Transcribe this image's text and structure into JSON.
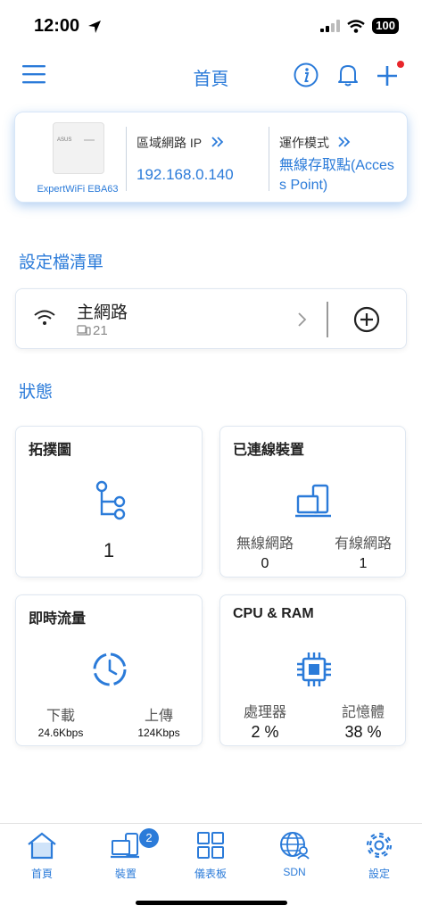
{
  "status_bar": {
    "time": "12:00",
    "battery": "100"
  },
  "header": {
    "title": "首頁"
  },
  "device": {
    "model": "ExpertWiFi EBA63",
    "ip_label": "區域網路 IP",
    "ip_value": "192.168.0.140",
    "mode_label": "運作模式",
    "mode_value": "無線存取點(Access Point)"
  },
  "profiles": {
    "title": "設定檔清單",
    "items": [
      {
        "name": "主網路",
        "count": "21"
      }
    ]
  },
  "status": {
    "title": "狀態",
    "topology": {
      "title": "拓撲圖",
      "value": "1"
    },
    "clients": {
      "title": "已連線裝置",
      "wireless_label": "無線網路",
      "wireless_value": "0",
      "wired_label": "有線網路",
      "wired_value": "1"
    },
    "traffic": {
      "title": "即時流量",
      "download_label": "下載",
      "download_value": "24.6Kbps",
      "upload_label": "上傳",
      "upload_value": "124Kbps"
    },
    "cpu_ram": {
      "title": "CPU & RAM",
      "cpu_label": "處理器",
      "cpu_value": "2 %",
      "ram_label": "記憶體",
      "ram_value": "38 %"
    }
  },
  "bottom_nav": {
    "items": [
      {
        "label": "首頁",
        "icon": "home-icon"
      },
      {
        "label": "裝置",
        "icon": "devices-icon",
        "badge": "2"
      },
      {
        "label": "儀表板",
        "icon": "dashboard-icon"
      },
      {
        "label": "SDN",
        "icon": "sdn-icon"
      },
      {
        "label": "設定",
        "icon": "settings-icon"
      }
    ]
  },
  "colors": {
    "accent": "#2b7bd9",
    "notification_dot": "#e8262b"
  }
}
